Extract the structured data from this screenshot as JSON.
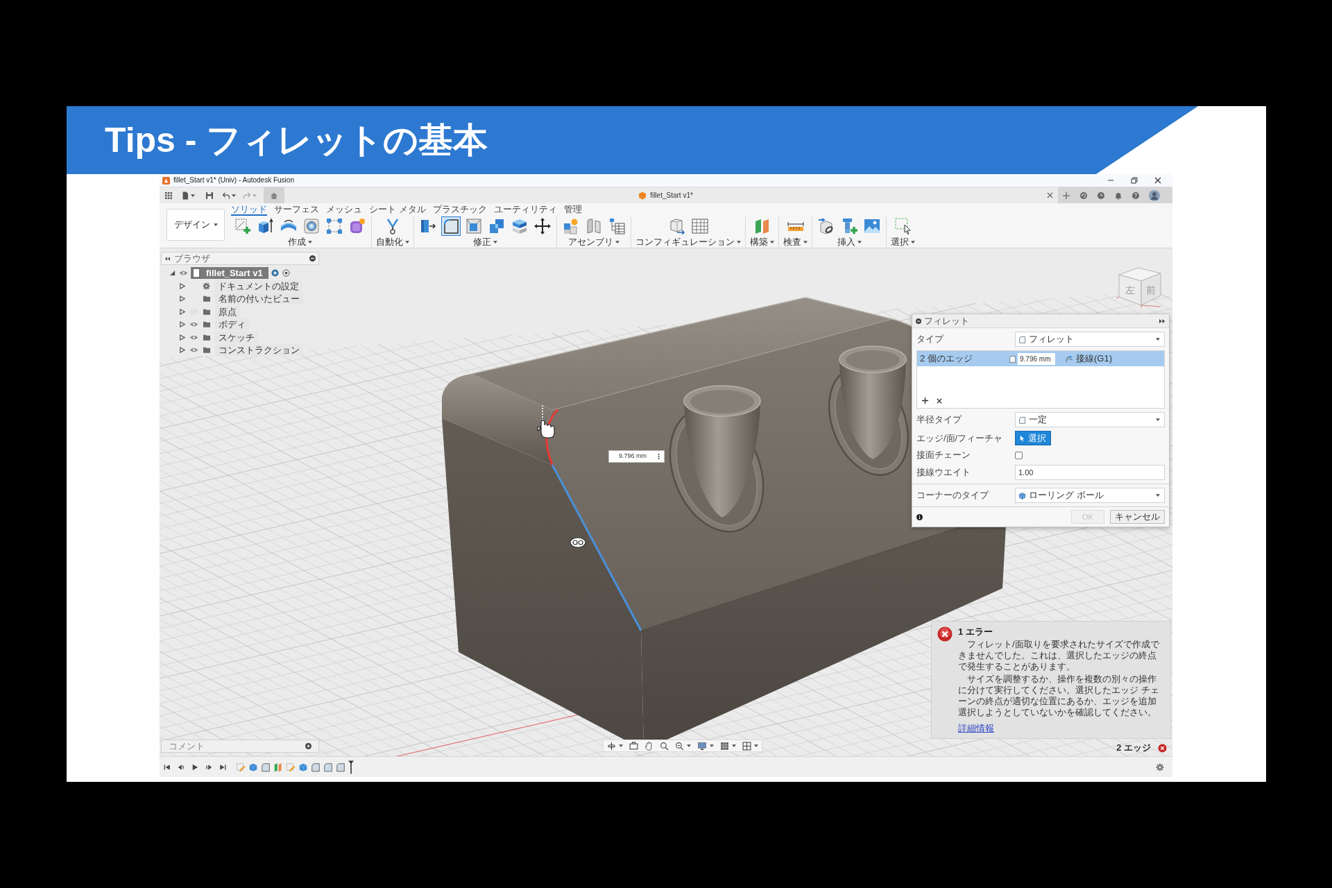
{
  "slide": {
    "title": "Tips - フィレットの基本"
  },
  "window": {
    "title": "fillet_Start v1* (Univ) - Autodesk Fusion",
    "document_tab": "fillet_Start v1*"
  },
  "toolbar": {
    "workspace": "デザイン",
    "tabs": [
      {
        "label": "ソリッド",
        "selected": true
      },
      {
        "label": "サーフェス",
        "selected": false
      },
      {
        "label": "メッシュ",
        "selected": false
      },
      {
        "label": "シート メタル",
        "selected": false
      },
      {
        "label": "プラスチック",
        "selected": false
      },
      {
        "label": "ユーティリティ",
        "selected": false
      },
      {
        "label": "管理",
        "selected": false
      }
    ],
    "groups": [
      {
        "label": "作成",
        "tools": [
          {
            "selected": false
          },
          {
            "selected": false
          },
          {
            "selected": false
          },
          {
            "selected": false
          },
          {
            "selected": false
          },
          {
            "selected": false
          }
        ]
      },
      {
        "label": "自動化",
        "tools": [
          {
            "selected": false
          }
        ]
      },
      {
        "label": "修正",
        "tools": [
          {
            "selected": false
          },
          {
            "selected": true
          },
          {
            "selected": false
          },
          {
            "selected": false
          },
          {
            "selected": false
          },
          {
            "selected": false
          }
        ]
      },
      {
        "label": "アセンブリ",
        "tools": [
          {
            "selected": false
          },
          {
            "selected": false
          },
          {
            "selected": false
          }
        ]
      },
      {
        "label": "コンフィギュレーション",
        "tools": [
          {
            "selected": false
          },
          {
            "selected": false
          }
        ]
      },
      {
        "label": "構築",
        "tools": [
          {
            "selected": false
          }
        ]
      },
      {
        "label": "検査",
        "tools": [
          {
            "selected": false
          }
        ]
      },
      {
        "label": "挿入",
        "tools": [
          {
            "selected": false
          },
          {
            "selected": false
          },
          {
            "selected": false
          }
        ]
      },
      {
        "label": "選択",
        "tools": [
          {
            "selected": false
          }
        ]
      }
    ]
  },
  "browser": {
    "title": "ブラウザ",
    "root": {
      "label": "fillet_Start v1",
      "selected": true,
      "expanded": true,
      "visible": true,
      "children": [
        {
          "label": "ドキュメントの設定",
          "kind": "gear",
          "selected": false,
          "expanded": false
        },
        {
          "label": "名前の付いたビュー",
          "kind": "folder",
          "selected": false,
          "expanded": false
        },
        {
          "label": "原点",
          "kind": "folder",
          "selected": false,
          "expanded": false,
          "visible": false
        },
        {
          "label": "ボディ",
          "kind": "folder",
          "selected": false,
          "expanded": false,
          "visible": true
        },
        {
          "label": "スケッチ",
          "kind": "folder",
          "selected": false,
          "expanded": false,
          "visible": true
        },
        {
          "label": "コンストラクション",
          "kind": "folder",
          "selected": false,
          "expanded": false,
          "visible": true
        }
      ]
    }
  },
  "viewport": {
    "view_cube": {
      "left": "左",
      "front": "前"
    },
    "dimension": "9.796 mm"
  },
  "fillet_dialog": {
    "title": "フィレット",
    "type": {
      "label": "タイプ",
      "value": "フィレット"
    },
    "edges": [
      {
        "label": "2 個のエッジ",
        "radius": "9.796 mm",
        "continuity": "接線(G1)",
        "selected": true
      }
    ],
    "radius_type": {
      "label": "半径タイプ",
      "value": "一定"
    },
    "edge_face_feature": {
      "label": "エッジ/面/フィーチャ",
      "button": "選択",
      "selected": true
    },
    "tangent_chain": {
      "label": "接面チェーン",
      "checked": false
    },
    "tangent_weight": {
      "label": "接線ウエイト",
      "value": "1.00"
    },
    "corner_type": {
      "label": "コーナーのタイプ",
      "value": "ローリング ボール"
    },
    "ok": {
      "label": "OK",
      "disabled": true
    },
    "cancel": "キャンセル"
  },
  "error_panel": {
    "title": "1 エラー",
    "paragraphs": [
      "フィレット/面取りを要求されたサイズで作成できませんでした。これは、選択したエッジの終点で発生することがあります。",
      "サイズを調整するか、操作を複数の別々の操作に分けて実行してください。選択したエッジ チェーンの終点が適切な位置にあるか、エッジを追加選択しようとしていないかを確認してください。"
    ],
    "link": "詳細情報"
  },
  "comments": {
    "label": "コメント"
  },
  "status_bar": {
    "selection": "2 エッジ"
  }
}
